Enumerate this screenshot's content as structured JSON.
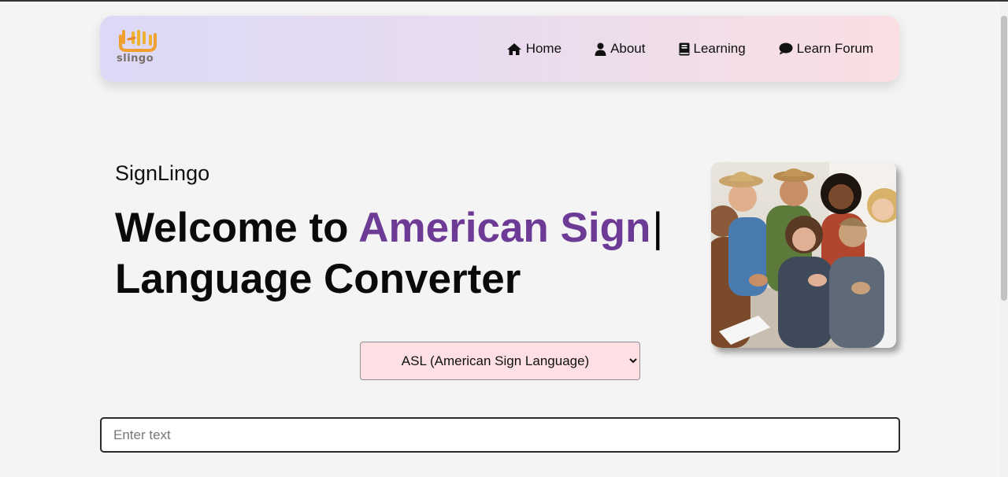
{
  "brand": {
    "logo_text": "slingo"
  },
  "nav": {
    "items": [
      {
        "label": "Home",
        "icon": "home-icon"
      },
      {
        "label": "About",
        "icon": "user-icon"
      },
      {
        "label": "Learning",
        "icon": "book-icon"
      },
      {
        "label": "Learn Forum",
        "icon": "comment-icon"
      }
    ]
  },
  "hero": {
    "subtitle": "SignLingo",
    "headline_prefix": "Welcome to ",
    "headline_accent": "American Sign",
    "headline_caret": "|",
    "headline_suffix": "Language Converter",
    "image_icon": "group-of-people-photo"
  },
  "converter": {
    "language_select": {
      "selected": "ASL (American Sign Language)",
      "options": [
        "ASL (American Sign Language)"
      ]
    },
    "text_input": {
      "value": "",
      "placeholder": "Enter text"
    }
  },
  "colors": {
    "accent": "#6d3a96",
    "navbar_gradient_start": "#dcd9f6",
    "navbar_gradient_end": "#fadfe3",
    "select_background": "#fee0e4",
    "logo_orange": "#f0a030"
  }
}
